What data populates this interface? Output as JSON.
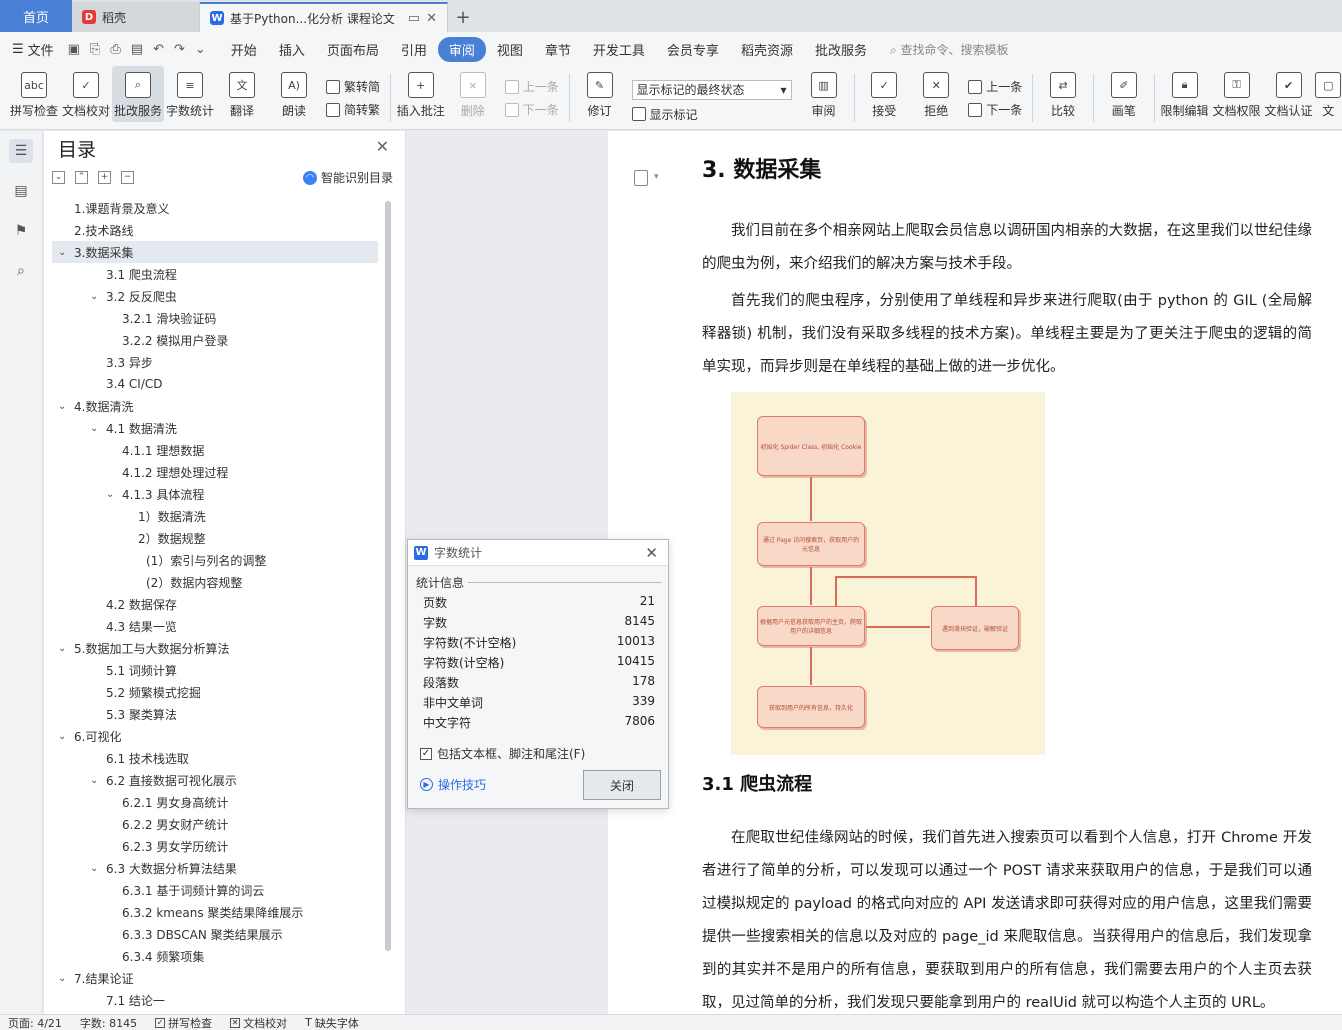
{
  "tabs": {
    "home": "首页",
    "daoke": "稻壳",
    "document": "基于Python...化分析 课程论文"
  },
  "menu": {
    "file": "文件",
    "items": [
      "开始",
      "插入",
      "页面布局",
      "引用",
      "审阅",
      "视图",
      "章节",
      "开发工具",
      "会员专享",
      "稻壳资源",
      "批改服务"
    ],
    "active_index": 4,
    "search_hint": "查找命令、搜索模板"
  },
  "ribbon": {
    "spell_check": "拼写检查",
    "doc_proofread": "文档校对",
    "correction_service": "批改服务",
    "word_count": "字数统计",
    "translate": "翻译",
    "read_aloud": "朗读",
    "trad_to_simp": "繁转简",
    "simp_to_trad": "简转繁",
    "insert_comment": "插入批注",
    "delete": "删除",
    "prev": "上一条",
    "next": "下一条",
    "track_changes": "修订",
    "markup_select": "显示标记的最终状态",
    "show_markup": "显示标记",
    "review": "审阅",
    "accept": "接受",
    "reject": "拒绝",
    "prev2": "上一条",
    "next2": "下一条",
    "compare": "比较",
    "pen": "画笔",
    "restrict_edit": "限制编辑",
    "doc_permission": "文档权限",
    "doc_auth": "文档认证",
    "doc_more": "文"
  },
  "toc": {
    "title": "目录",
    "smart": "智能识别目录",
    "items": [
      {
        "text": "1.课题背景及意义",
        "level": 0,
        "chev": ""
      },
      {
        "text": "2.技术路线",
        "level": 0,
        "chev": ""
      },
      {
        "text": "3.数据采集",
        "level": 0,
        "chev": "v",
        "selected": true
      },
      {
        "text": "3.1  爬虫流程",
        "level": 1,
        "chev": ""
      },
      {
        "text": "3.2  反反爬虫",
        "level": 1,
        "chev": "v"
      },
      {
        "text": "3.2.1  滑块验证码",
        "level": 2,
        "chev": ""
      },
      {
        "text": "3.2.2  模拟用户登录",
        "level": 2,
        "chev": ""
      },
      {
        "text": "3.3  异步",
        "level": 1,
        "chev": ""
      },
      {
        "text": "3.4 CI/CD",
        "level": 1,
        "chev": ""
      },
      {
        "text": "4.数据清洗",
        "level": 0,
        "chev": "v"
      },
      {
        "text": "4.1  数据清洗",
        "level": 1,
        "chev": "v"
      },
      {
        "text": "4.1.1  理想数据",
        "level": 2,
        "chev": ""
      },
      {
        "text": "4.1.2  理想处理过程",
        "level": 2,
        "chev": ""
      },
      {
        "text": "4.1.3  具体流程",
        "level": 2,
        "chev": "v"
      },
      {
        "text": "1）数据清洗",
        "level": 3,
        "chev": ""
      },
      {
        "text": "2）数据规整",
        "level": 3,
        "chev": ""
      },
      {
        "text": "(1）索引与列名的调整",
        "level": 4,
        "chev": ""
      },
      {
        "text": "(2）数据内容规整",
        "level": 4,
        "chev": ""
      },
      {
        "text": "4.2  数据保存",
        "level": 1,
        "chev": ""
      },
      {
        "text": "4.3  结果一览",
        "level": 1,
        "chev": ""
      },
      {
        "text": "5.数据加工与大数据分析算法",
        "level": 0,
        "chev": "v"
      },
      {
        "text": "5.1  词频计算",
        "level": 1,
        "chev": ""
      },
      {
        "text": "5.2  频繁模式挖掘",
        "level": 1,
        "chev": ""
      },
      {
        "text": "5.3  聚类算法",
        "level": 1,
        "chev": ""
      },
      {
        "text": "6.可视化",
        "level": 0,
        "chev": "v"
      },
      {
        "text": "6.1  技术栈选取",
        "level": 1,
        "chev": ""
      },
      {
        "text": "6.2  直接数据可视化展示",
        "level": 1,
        "chev": "v"
      },
      {
        "text": "6.2.1  男女身高统计",
        "level": 2,
        "chev": ""
      },
      {
        "text": "6.2.2  男女财产统计",
        "level": 2,
        "chev": ""
      },
      {
        "text": "6.2.3  男女学历统计",
        "level": 2,
        "chev": ""
      },
      {
        "text": "6.3  大数据分析算法结果",
        "level": 1,
        "chev": "v"
      },
      {
        "text": "6.3.1  基于词频计算的词云",
        "level": 2,
        "chev": ""
      },
      {
        "text": "6.3.2 kmeans 聚类结果降维展示",
        "level": 2,
        "chev": ""
      },
      {
        "text": "6.3.3 DBSCAN 聚类结果展示",
        "level": 2,
        "chev": ""
      },
      {
        "text": "6.3.4  频繁项集",
        "level": 2,
        "chev": ""
      },
      {
        "text": "7.结果论证",
        "level": 0,
        "chev": "v"
      },
      {
        "text": "7.1  结论一",
        "level": 1,
        "chev": ""
      }
    ]
  },
  "document": {
    "h1": "3. 数据采集",
    "p1": "我们目前在多个相亲网站上爬取会员信息以调研国内相亲的大数据，在这里我们以世纪佳缘的爬虫为例，来介绍我们的解决方案与技术手段。",
    "p2": "首先我们的爬虫程序，分别使用了单线程和异步来进行爬取(由于 python 的 GIL (全局解释器锁) 机制，我们没有采取多线程的技术方案)。单线程主要是为了更关注于爬虫的逻辑的简单实现，而异步则是在单线程的基础上做的进一步优化。",
    "h2": "3.1  爬虫流程",
    "p3": "在爬取世纪佳缘网站的时候，我们首先进入搜索页可以看到个人信息，打开 Chrome 开发者进行了简单的分析，可以发现可以通过一个 POST 请求来获取用户的信息，于是我们可以通过模拟规定的 payload 的格式向对应的 API 发送请求即可获得对应的用户信息，这里我们需要提供一些搜索相关的信息以及对应的 page_id 来爬取信息。当获得用户的信息后，我们发现拿到的其实并不是用户的所有信息，要获取到用户的所有信息，我们需要去用户的个人主页去获取，见过简单的分析，我们发现只要能拿到用户的 realUid 就可以构造个人主页的 URL。",
    "flow": {
      "box1": "初始化 Spider Class, 初始化 Cookie",
      "box2": "通过 Page 访问搜索页，获取用户的元信息",
      "box3": "根据用户元信息获取用户的主页，爬取用户的详细信息",
      "box4": "遇到滑块验证，破解验证",
      "box5": "获取到用户的所有信息，持久化"
    }
  },
  "dialog": {
    "title": "字数统计",
    "section": "统计信息",
    "rows": [
      {
        "label": "页数",
        "value": "21"
      },
      {
        "label": "字数",
        "value": "8145"
      },
      {
        "label": "字符数(不计空格)",
        "value": "10013"
      },
      {
        "label": "字符数(计空格)",
        "value": "10415"
      },
      {
        "label": "段落数",
        "value": "178"
      },
      {
        "label": "非中文单词",
        "value": "339"
      },
      {
        "label": "中文字符",
        "value": "7806"
      }
    ],
    "checkbox": "包括文本框、脚注和尾注(F)",
    "tips": "操作技巧",
    "close": "关闭"
  },
  "status": {
    "page": "页面: 4/21",
    "words": "字数: 8145",
    "spell": "拼写检查",
    "proof": "文档校对",
    "missing_font": "缺失字体"
  }
}
